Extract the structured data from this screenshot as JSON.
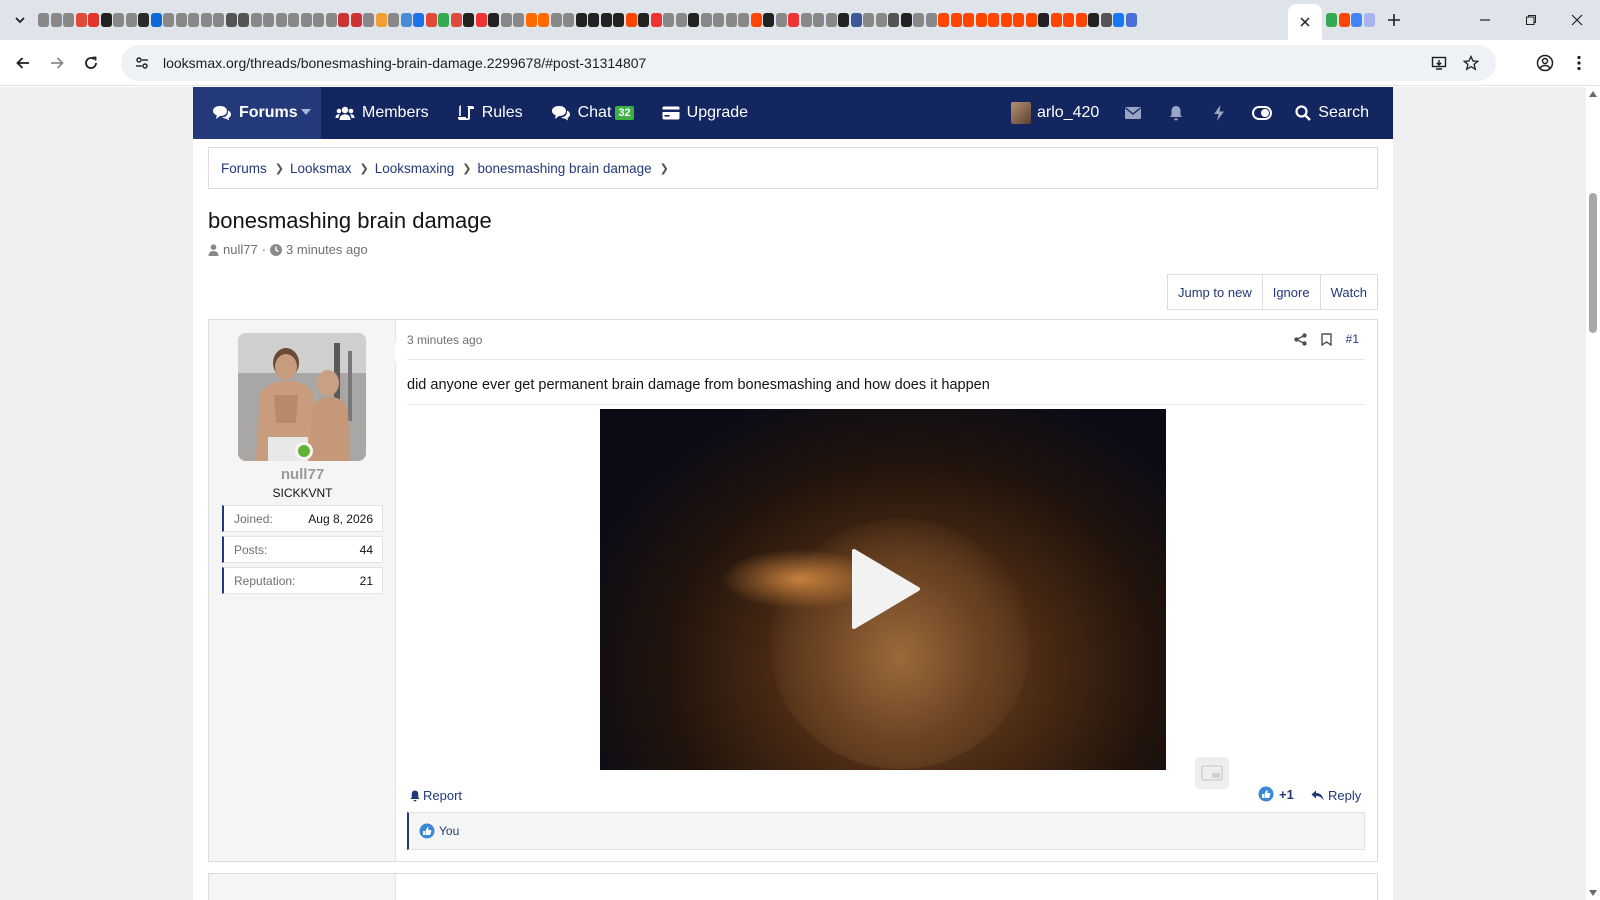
{
  "browser": {
    "url": "looksmax.org/threads/bonesmashing-brain-damage.2299678/#post-31314807",
    "favicon_colors": [
      "#888",
      "#888",
      "#888",
      "#e04a3a",
      "#e5352b",
      "#222",
      "#888",
      "#888",
      "#2a2a2a",
      "#0a6ad8",
      "#888",
      "#888",
      "#888",
      "#888",
      "#888",
      "#555",
      "#555",
      "#888",
      "#888",
      "#888",
      "#888",
      "#888",
      "#888",
      "#888",
      "#c33",
      "#c33",
      "#888",
      "#f29d38",
      "#888",
      "#4a8bd6",
      "#1a73e8",
      "#e04a3a",
      "#34a853",
      "#e04a3a",
      "#222",
      "#e33",
      "#222",
      "#888",
      "#888",
      "#ff6a00",
      "#ff6a00",
      "#888",
      "#888",
      "#222",
      "#222",
      "#222",
      "#222",
      "#ff4500",
      "#222",
      "#e33",
      "#888",
      "#888",
      "#222",
      "#888",
      "#888",
      "#888",
      "#888",
      "#ff4500",
      "#222",
      "#888",
      "#e33",
      "#888",
      "#888",
      "#888",
      "#222",
      "#3b5998",
      "#888",
      "#888",
      "#555",
      "#222",
      "#888",
      "#888",
      "#ff4500",
      "#ff4500",
      "#ff4500",
      "#ff4500",
      "#ff4500",
      "#ff4500",
      "#ff4500",
      "#ff4500",
      "#222",
      "#ff4500",
      "#ff4500",
      "#ff4500",
      "#222",
      "#555",
      "#1877f2",
      "#4a6fd6"
    ]
  },
  "nav": {
    "forums": "Forums",
    "members": "Members",
    "rules": "Rules",
    "chat": "Chat",
    "chat_count": "32",
    "upgrade": "Upgrade",
    "username": "arlo_420",
    "search": "Search",
    "colors": {
      "bar": "#132660",
      "active": "#23397a",
      "badge": "#3cb043"
    }
  },
  "breadcrumb": [
    "Forums",
    "Looksmax",
    "Looksmaxing",
    "bonesmashing brain damage"
  ],
  "thread": {
    "title": "bonesmashing brain damage",
    "author": "null77",
    "time": "3 minutes ago",
    "buttons": {
      "jump": "Jump to new",
      "ignore": "Ignore",
      "watch": "Watch"
    }
  },
  "post": {
    "username": "null77",
    "user_title": "SICKKVNT",
    "stats": [
      {
        "label": "Joined:",
        "value": "Aug 8, 2026"
      },
      {
        "label": "Posts:",
        "value": "44"
      },
      {
        "label": "Reputation:",
        "value": "21"
      }
    ],
    "time": "3 minutes ago",
    "number": "#1",
    "text": "did anyone ever get permanent brain damage from bonesmashing and how does it happen",
    "report": "Report",
    "reaction_count": "+1",
    "reply": "Reply",
    "reacted_by": "You"
  }
}
